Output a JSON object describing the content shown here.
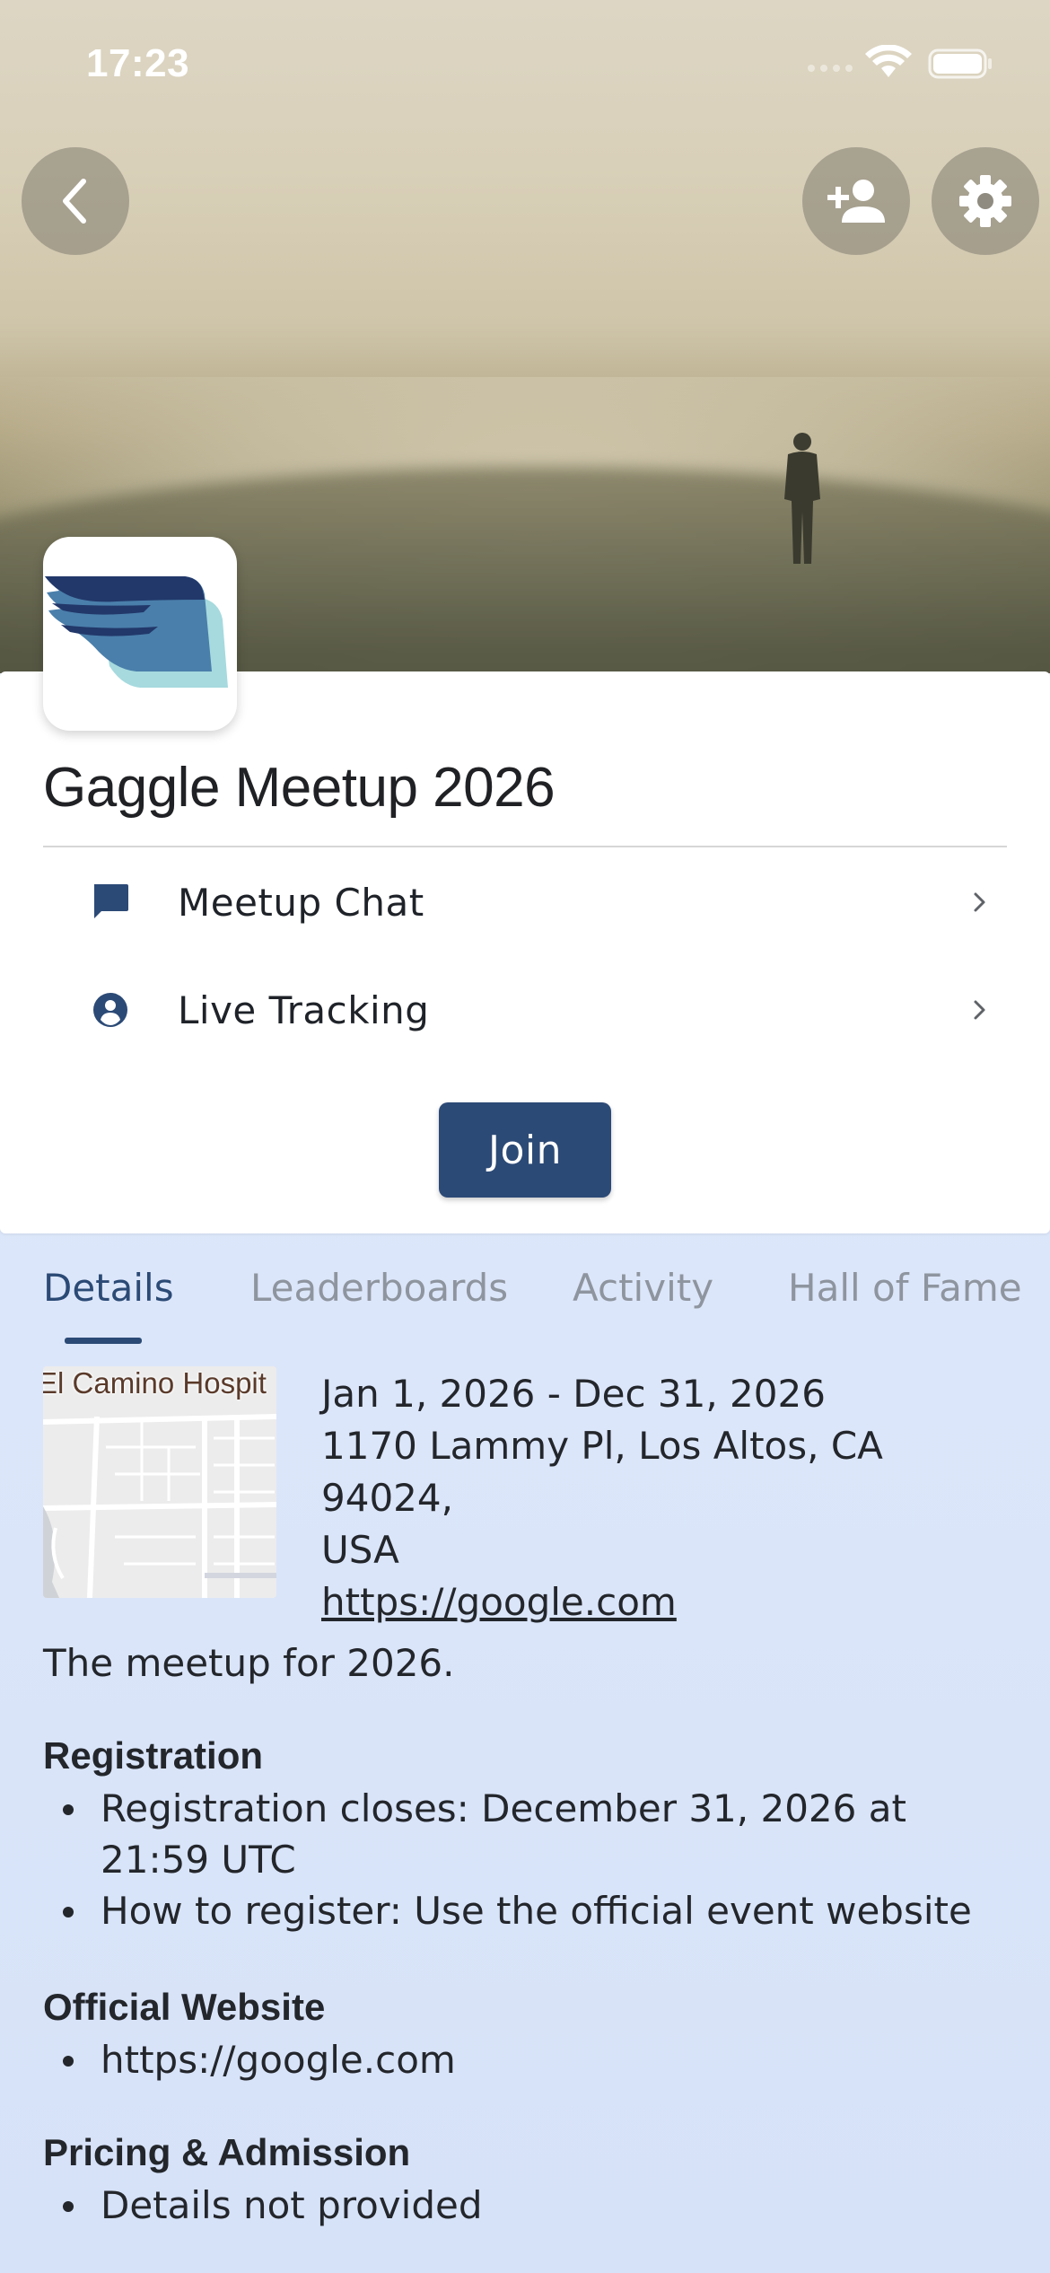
{
  "status_bar": {
    "time": "17:23"
  },
  "event": {
    "title": "Gaggle Meetup 2026",
    "menu": [
      {
        "label": "Meetup Chat",
        "icon": "chat-bubble-icon"
      },
      {
        "label": "Live Tracking",
        "icon": "person-pin-icon"
      }
    ],
    "join_label": "Join"
  },
  "tabs": [
    {
      "label": "Details",
      "active": true
    },
    {
      "label": "Leaderboards",
      "active": false
    },
    {
      "label": "Activity",
      "active": false
    },
    {
      "label": "Hall of Fame",
      "active": false
    }
  ],
  "details": {
    "map_label": "El Camino Hospit",
    "date_range": "Jan 1, 2026 - Dec 31, 2026",
    "address_line1": "1170 Lammy Pl, Los Altos, CA 94024,",
    "address_line2": "USA",
    "link": "https://google.com",
    "description": "The meetup for 2026.",
    "sections": [
      {
        "heading": "Registration",
        "items": [
          "Registration closes: December 31, 2026 at 21:59 UTC",
          "How to register: Use the official event website"
        ]
      },
      {
        "heading": "Official Website",
        "items": [
          "https://google.com"
        ]
      },
      {
        "heading": "Pricing & Admission",
        "items": [
          "Details not provided"
        ]
      }
    ]
  },
  "colors": {
    "primary": "#2c4a76",
    "tab_inactive": "#8e959f",
    "background": "#e2eafa"
  }
}
